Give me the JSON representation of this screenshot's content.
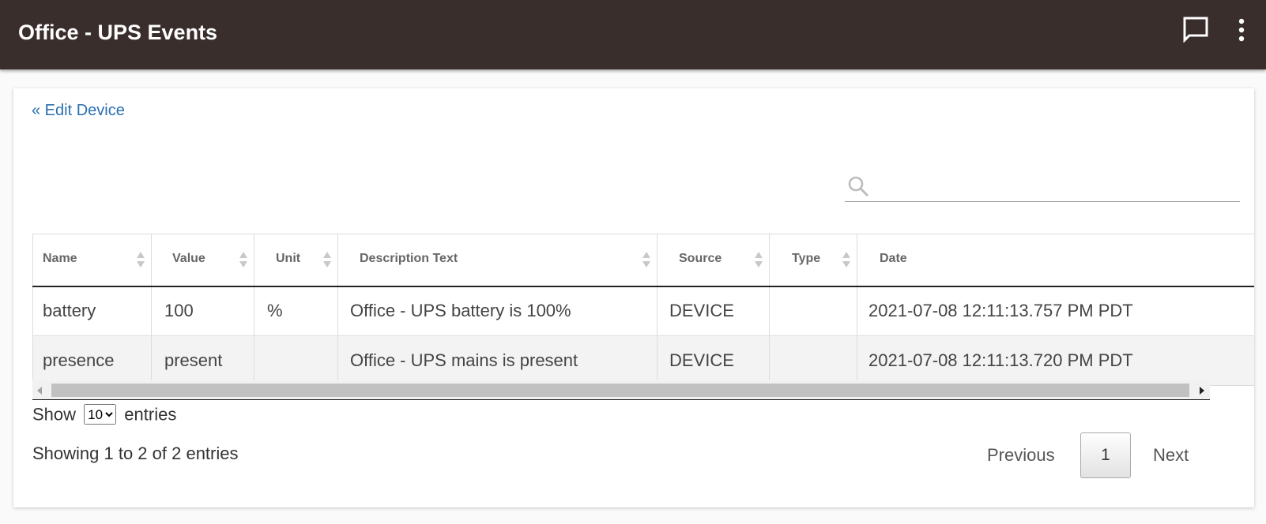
{
  "header": {
    "title": "Office - UPS Events",
    "icons": {
      "chat": "chat-bubble-icon",
      "more": "more-vertical-icon"
    }
  },
  "nav": {
    "back_link": "« Edit Device"
  },
  "search": {
    "value": "",
    "placeholder": "",
    "icon": "search-icon"
  },
  "table": {
    "columns": [
      "Name",
      "Value",
      "Unit",
      "Description Text",
      "Source",
      "Type",
      "Date"
    ],
    "sorted_column": "Date",
    "sort_direction": "descending",
    "rows": [
      [
        "battery",
        "100",
        "%",
        "Office - UPS battery is 100%",
        "DEVICE",
        "",
        "2021-07-08 12:11:13.757 PM PDT"
      ],
      [
        "presence",
        "present",
        "",
        "Office - UPS mains is present",
        "DEVICE",
        "",
        "2021-07-08 12:11:13.720 PM PDT"
      ]
    ]
  },
  "length_menu": {
    "show_label": "Show",
    "selected": "10",
    "entries_label": "entries"
  },
  "info": "Showing 1 to 2 of 2 entries",
  "pagination": {
    "previous": "Previous",
    "current_page": "1",
    "next": "Next"
  },
  "colors": {
    "header_bg": "#3a2e2c",
    "link": "#2a6fb0"
  }
}
